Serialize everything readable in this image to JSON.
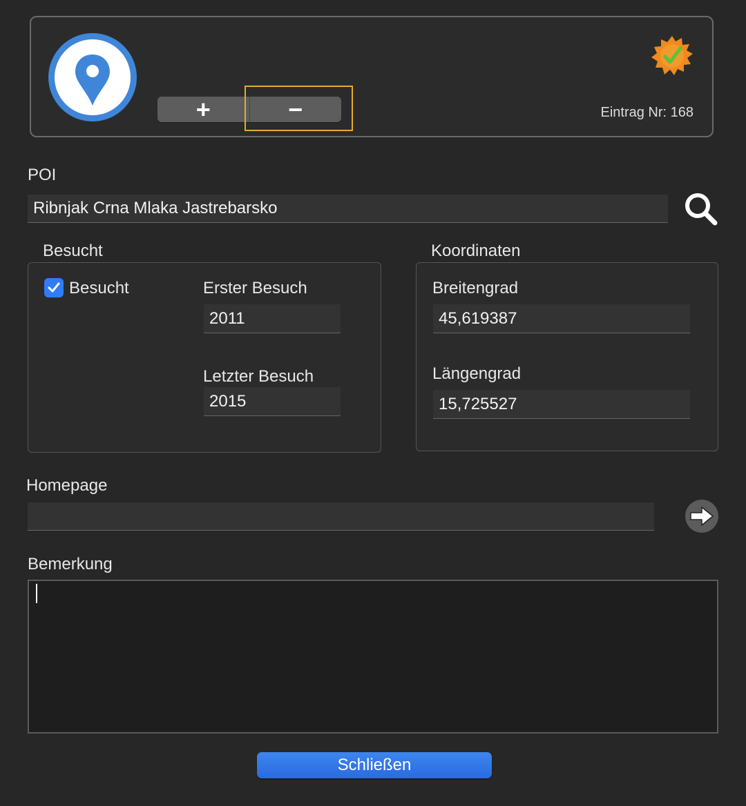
{
  "header": {
    "add_symbol": "+",
    "remove_symbol": "−",
    "entry_label": "Eintrag Nr: 168",
    "logo_icon": "map-pin-icon",
    "badge_icon": "verified-badge-icon"
  },
  "poi": {
    "label": "POI",
    "value": "Ribnjak Crna Mlaka Jastrebarsko",
    "search_icon": "search-icon"
  },
  "besucht": {
    "group_title": "Besucht",
    "checkbox_label": "Besucht",
    "checked": true,
    "first_visit_label": "Erster Besuch",
    "first_visit_value": "2011",
    "last_visit_label": "Letzter Besuch",
    "last_visit_value": "2015"
  },
  "koordinaten": {
    "group_title": "Koordinaten",
    "lat_label": "Breitengrad",
    "lat_value": "45,619387",
    "lon_label": "Längengrad",
    "lon_value": "15,725527"
  },
  "homepage": {
    "label": "Homepage",
    "value": "",
    "go_icon": "arrow-right-icon"
  },
  "bemerkung": {
    "label": "Bemerkung",
    "value": ""
  },
  "footer": {
    "close_label": "Schließen"
  },
  "colors": {
    "accent": "#2f7cf6",
    "focus_ring": "#e4ad2b",
    "logo_blue": "#3f86d8",
    "badge_orange": "#ef8a1e",
    "check_green": "#5cc23a"
  }
}
